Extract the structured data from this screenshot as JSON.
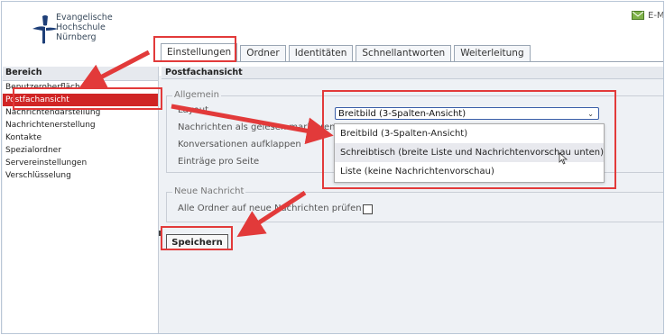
{
  "header": {
    "logo_lines": [
      "Evangelische",
      "Hochschule",
      "Nürnberg"
    ],
    "email_label": "E-Ma"
  },
  "tabs": [
    {
      "label": "Einstellungen",
      "active": true
    },
    {
      "label": "Ordner"
    },
    {
      "label": "Identitäten"
    },
    {
      "label": "Schnellantworten"
    },
    {
      "label": "Weiterleitung"
    }
  ],
  "sidebar": {
    "heading": "Bereich",
    "items": [
      "Benutzeroberfläche",
      "Postfachansicht",
      "Nachrichtendarstellung",
      "Nachrichtenerstellung",
      "Kontakte",
      "Spezialordner",
      "Servereinstellungen",
      "Verschlüsselung"
    ],
    "active_index": 1
  },
  "main": {
    "heading": "Postfachansicht",
    "general": {
      "legend": "Allgemein",
      "rows": [
        "Layout",
        "Nachrichten als gelesen markieren",
        "Konversationen aufklappen",
        "Einträge pro Seite"
      ]
    },
    "layout_select": {
      "value": "Breitbild (3-Spalten-Ansicht)",
      "options": [
        "Breitbild (3-Spalten-Ansicht)",
        "Schreibtisch (breite Liste und Nachrichtenvorschau unten)",
        "Liste (keine Nachrichtenvorschau)"
      ],
      "hover_index": 1
    },
    "new_mail": {
      "legend": "Neue Nachricht",
      "check_all_label": "Alle Ordner auf neue Nachrichten prüfen",
      "checked": false
    },
    "save_label": "Speichern"
  },
  "colors": {
    "accent_red": "#d02525",
    "annotation_red": "#e23a3a"
  }
}
